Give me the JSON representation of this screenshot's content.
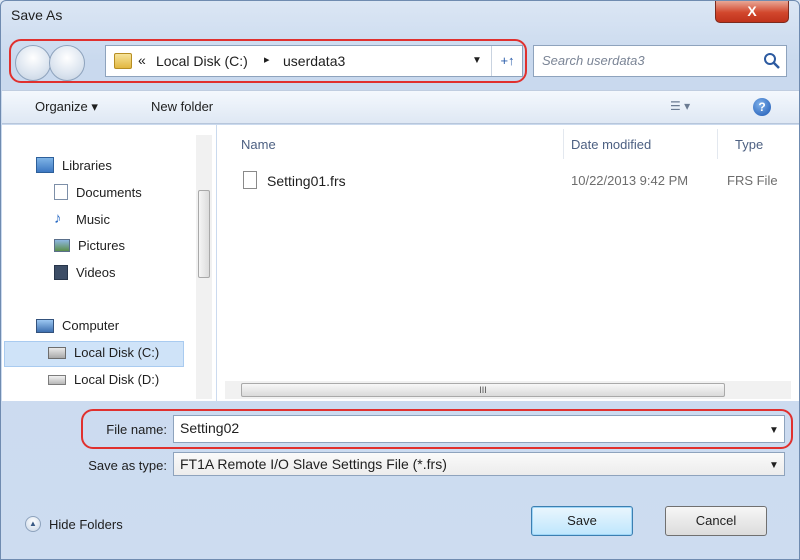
{
  "window": {
    "title": "Save As",
    "close_label": "X"
  },
  "address": {
    "chevrons": "«",
    "segment1": "Local Disk (C:)",
    "separator": "▸",
    "segment2": "userdata3",
    "dropdown": "▼",
    "refresh": "+↑"
  },
  "search": {
    "placeholder": "Search userdata3"
  },
  "toolbar": {
    "organize_label": "Organize ▾",
    "new_folder_label": "New folder",
    "views_label": "☰ ▾",
    "help_label": "?"
  },
  "nav": {
    "libraries": "Libraries",
    "documents": "Documents",
    "music": "Music",
    "pictures": "Pictures",
    "videos": "Videos",
    "computer": "Computer",
    "disk_c": "Local Disk (C:)",
    "disk_d": "Local Disk (D:)"
  },
  "columns": {
    "name": "Name",
    "date": "Date modified",
    "type": "Type"
  },
  "files": [
    {
      "name": "Setting01.frs",
      "date": "10/22/2013 9:42 PM",
      "type": "FRS File"
    }
  ],
  "scroll": {
    "grip": "III"
  },
  "filename": {
    "label": "File name:",
    "value": "Setting02"
  },
  "savetype": {
    "label": "Save as type:",
    "value": "FT1A Remote I/O Slave Settings File (*.frs)"
  },
  "bottom": {
    "hide_folders": "Hide Folders",
    "save": "Save",
    "cancel": "Cancel"
  },
  "colors": {
    "highlight_ring": "#e0302e",
    "selection": "#cfe3f8"
  }
}
